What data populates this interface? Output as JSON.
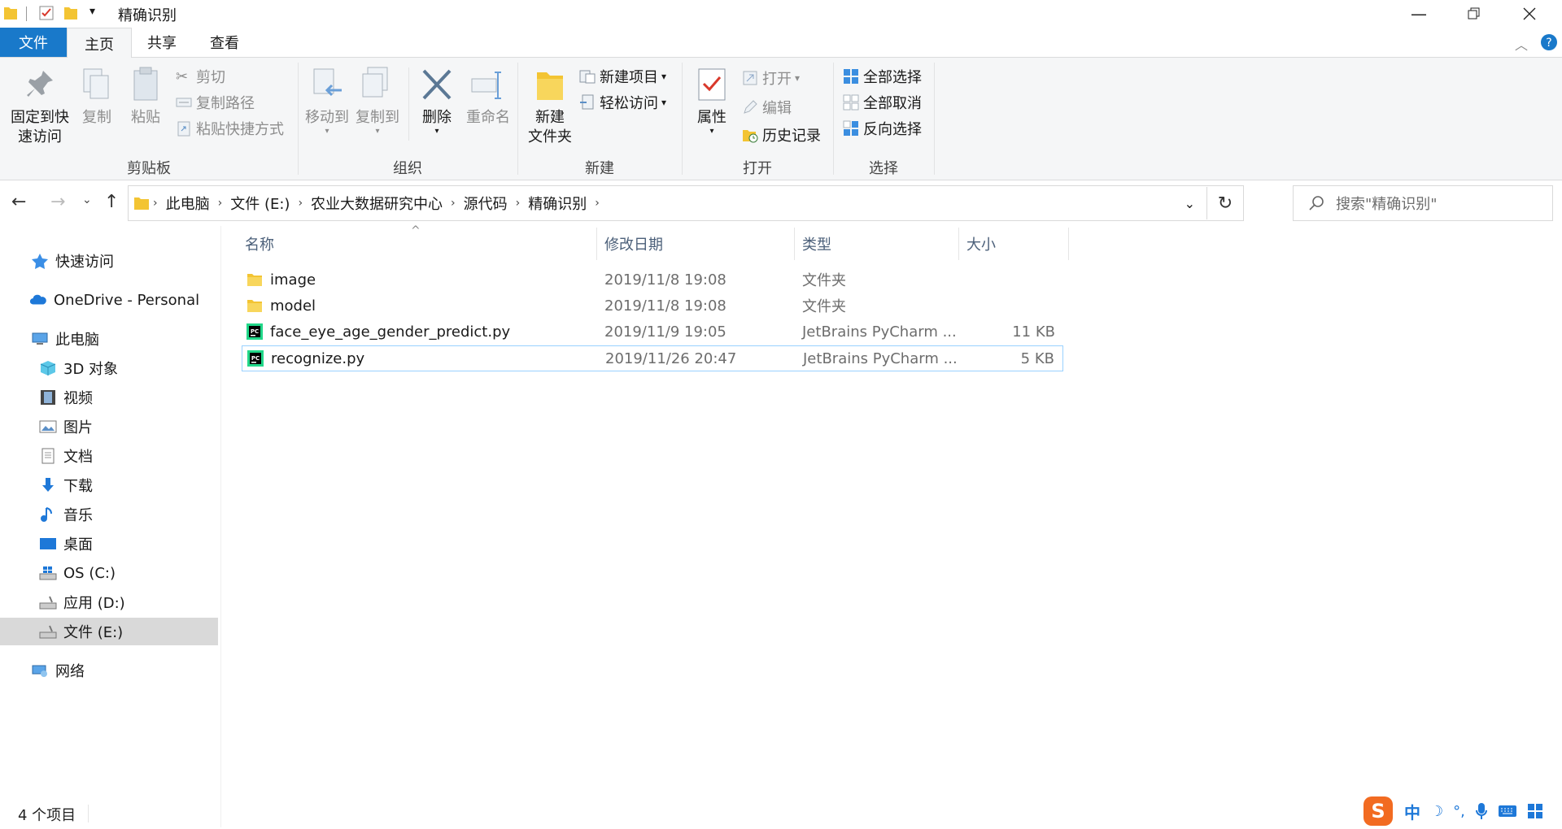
{
  "window": {
    "title": "精确识别",
    "controls": [
      "minimize",
      "restore",
      "close"
    ]
  },
  "ribbon": {
    "tabs": [
      "文件",
      "主页",
      "共享",
      "查看"
    ],
    "active_tab": "主页",
    "groups": {
      "clipboard": {
        "label": "剪贴板",
        "pin": "固定到快速访问",
        "pin_line1": "固定到快",
        "pin_line2": "速访问",
        "copy": "复制",
        "paste": "粘贴",
        "cut": "剪切",
        "copy_path": "复制路径",
        "paste_shortcut": "粘贴快捷方式"
      },
      "organize": {
        "label": "组织",
        "move_to": "移动到",
        "copy_to": "复制到",
        "delete": "删除",
        "rename": "重命名"
      },
      "new": {
        "label": "新建",
        "new_folder_line1": "新建",
        "new_folder_line2": "文件夹",
        "new_item": "新建项目",
        "easy_access": "轻松访问"
      },
      "open": {
        "label": "打开",
        "properties": "属性",
        "open": "打开",
        "edit": "编辑",
        "history": "历史记录"
      },
      "select": {
        "label": "选择",
        "select_all": "全部选择",
        "select_none": "全部取消",
        "invert": "反向选择"
      }
    }
  },
  "address": {
    "crumbs": [
      "此电脑",
      "文件 (E:)",
      "农业大数据研究中心",
      "源代码",
      "精确识别"
    ],
    "search_placeholder": "搜索\"精确识别\""
  },
  "nav": {
    "items": [
      {
        "label": "快速访问",
        "icon": "star-icon"
      },
      {
        "label": "OneDrive - Personal",
        "icon": "cloud-icon"
      },
      {
        "label": "此电脑",
        "icon": "computer-icon"
      },
      {
        "label": "3D 对象",
        "icon": "cube-icon"
      },
      {
        "label": "视频",
        "icon": "film-icon"
      },
      {
        "label": "图片",
        "icon": "picture-icon"
      },
      {
        "label": "文档",
        "icon": "document-icon"
      },
      {
        "label": "下载",
        "icon": "download-icon"
      },
      {
        "label": "音乐",
        "icon": "music-icon"
      },
      {
        "label": "桌面",
        "icon": "desktop-icon"
      },
      {
        "label": "OS (C:)",
        "icon": "windows-drive-icon"
      },
      {
        "label": "应用 (D:)",
        "icon": "drive-icon"
      },
      {
        "label": "文件 (E:)",
        "icon": "drive-icon"
      },
      {
        "label": "网络",
        "icon": "network-icon"
      }
    ],
    "selected": "文件 (E:)"
  },
  "filelist": {
    "columns": [
      "名称",
      "修改日期",
      "类型",
      "大小"
    ],
    "rows": [
      {
        "name": "image",
        "date": "2019/11/8 19:08",
        "type": "文件夹",
        "size": "",
        "icon": "folder-icon"
      },
      {
        "name": "model",
        "date": "2019/11/8 19:08",
        "type": "文件夹",
        "size": "",
        "icon": "folder-icon"
      },
      {
        "name": "face_eye_age_gender_predict.py",
        "date": "2019/11/9 19:05",
        "type": "JetBrains PyCharm ...",
        "size": "11 KB",
        "icon": "pycharm-icon"
      },
      {
        "name": "recognize.py",
        "date": "2019/11/26 20:47",
        "type": "JetBrains PyCharm ...",
        "size": "5 KB",
        "icon": "pycharm-icon"
      }
    ],
    "selected_row": "recognize.py"
  },
  "status": {
    "item_count": "4 个项目"
  },
  "ime": {
    "mode": "中"
  },
  "colors": {
    "file_tab": "#1979ca",
    "ribbon_bg": "#f5f6f7",
    "nav_selected": "#d9d9d9",
    "row_selected_border": "#99d1ff",
    "header_text": "#4c607a"
  }
}
